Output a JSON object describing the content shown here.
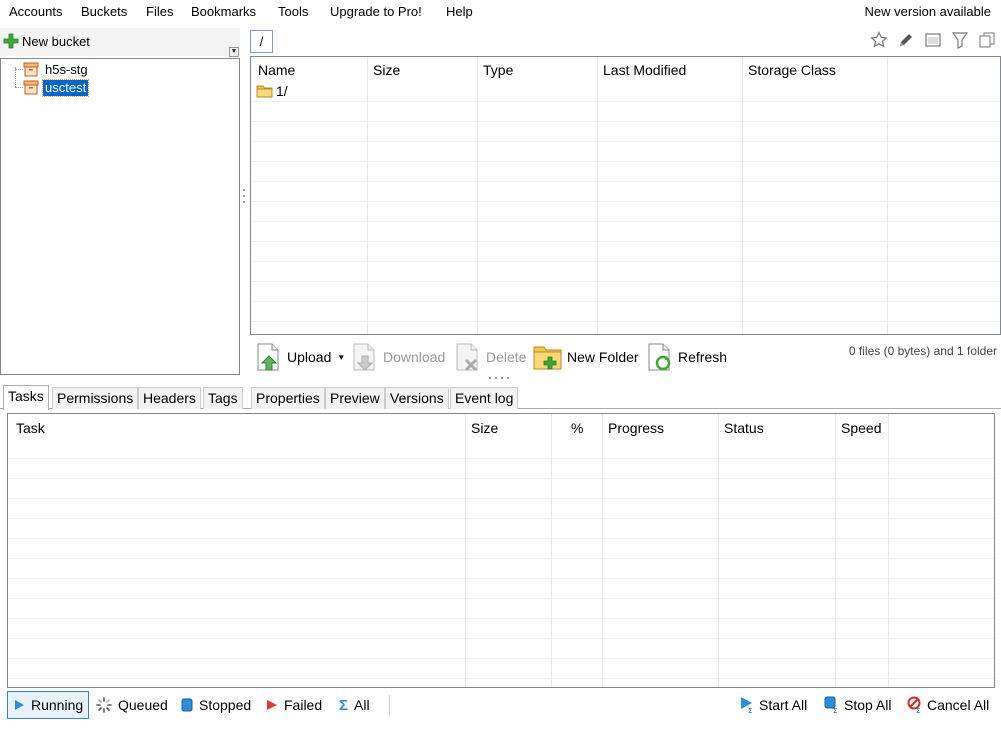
{
  "menu": {
    "items": [
      "Accounts",
      "Buckets",
      "Files",
      "Bookmarks",
      "Tools",
      "Upgrade to Pro!",
      "Help"
    ],
    "notice": "New version available"
  },
  "buckets": {
    "new_label": "New bucket",
    "items": [
      {
        "name": "h5s-stg",
        "selected": false
      },
      {
        "name": "usctest",
        "selected": true
      }
    ]
  },
  "path": {
    "value": "/"
  },
  "file_list": {
    "columns": [
      "Name",
      "Size",
      "Type",
      "Last Modified",
      "Storage Class"
    ],
    "rows": [
      {
        "name": "1/",
        "size": "",
        "type": "",
        "modified": "",
        "storage_class": ""
      }
    ]
  },
  "actions": {
    "upload": "Upload",
    "download": "Download",
    "delete": "Delete",
    "new_folder": "New Folder",
    "refresh": "Refresh",
    "file_count": "0 files (0 bytes) and 1 folder"
  },
  "tabs": [
    "Tasks",
    "Permissions",
    "Headers",
    "Tags",
    "Properties",
    "Preview",
    "Versions",
    "Event log"
  ],
  "task_list": {
    "columns": [
      "Task",
      "Size",
      "%",
      "Progress",
      "Status",
      "Speed"
    ]
  },
  "status": {
    "filters": [
      "Running",
      "Queued",
      "Stopped",
      "Failed",
      "All"
    ],
    "start_all": "Start All",
    "stop_all": "Stop All",
    "cancel_all": "Cancel All"
  },
  "colors": {
    "selection": "#0066cc",
    "accent_green": "#3aa935",
    "bucket_orange": "#e8893a",
    "folder_yellow": "#f5c542"
  }
}
